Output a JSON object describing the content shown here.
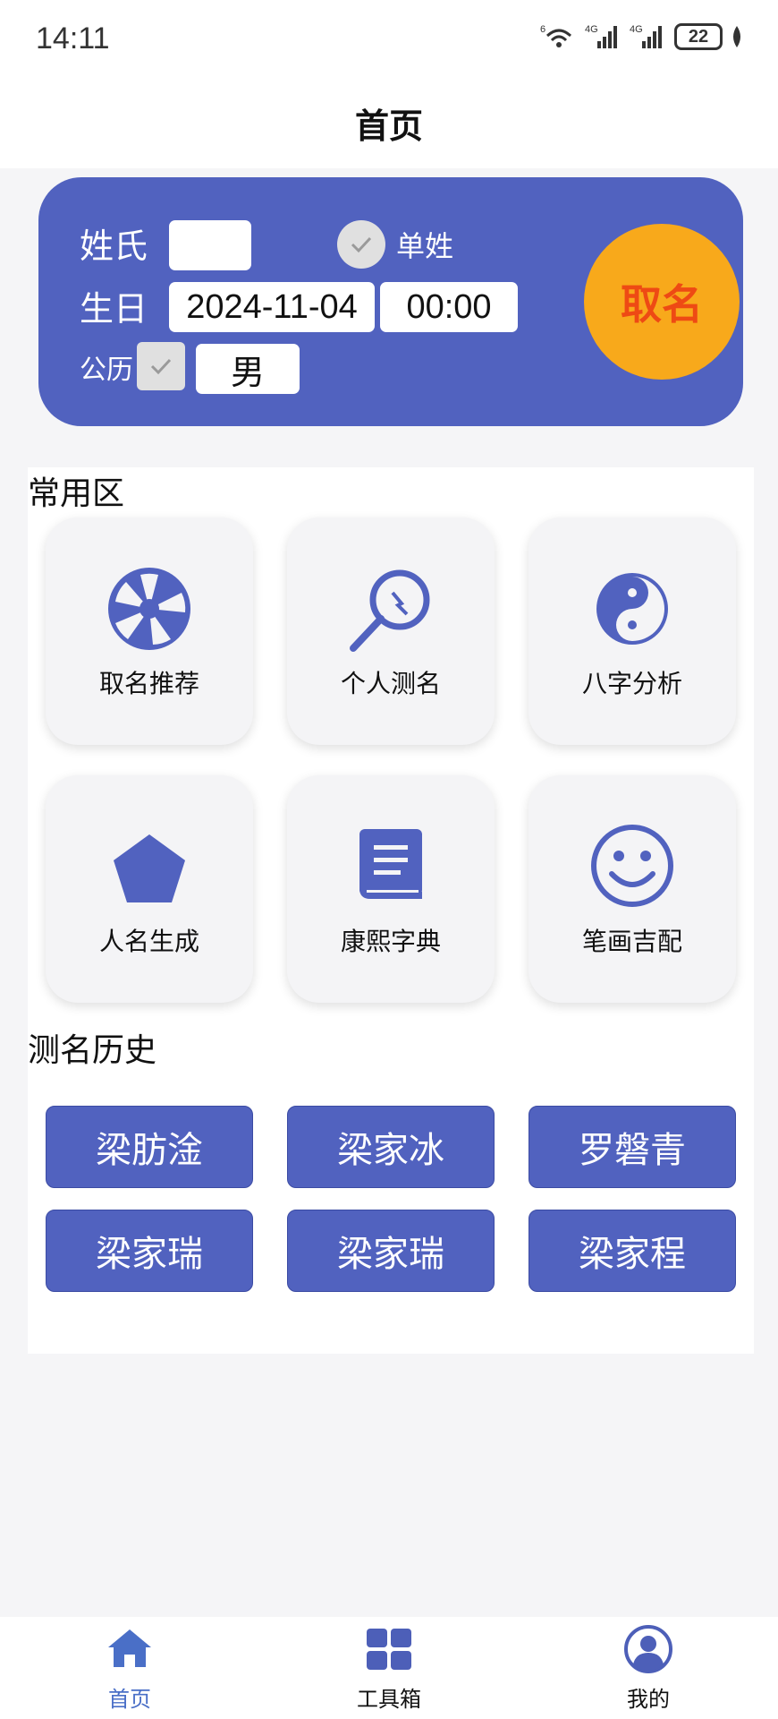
{
  "status": {
    "time": "14:11",
    "battery": "22",
    "net1": "6",
    "net2": "4G",
    "net3": "4G"
  },
  "nav": {
    "title": "首页"
  },
  "form": {
    "surname_label": "姓氏",
    "surname_value": "",
    "single_surname_label": "单姓",
    "birthday_label": "生日",
    "date_value": "2024-11-04",
    "time_value": "00:00",
    "calendar_label": "公历",
    "gender_value": "男",
    "submit_label": "取名"
  },
  "common": {
    "title": "常用区",
    "tiles": [
      {
        "label": "取名推荐",
        "icon": "wheel-icon"
      },
      {
        "label": "个人测名",
        "icon": "magnifier-icon"
      },
      {
        "label": "八字分析",
        "icon": "yin-yang-icon"
      },
      {
        "label": "人名生成",
        "icon": "pentagon-icon"
      },
      {
        "label": "康熙字典",
        "icon": "book-icon"
      },
      {
        "label": "笔画吉配",
        "icon": "smiley-icon"
      }
    ]
  },
  "history": {
    "title": "测名历史",
    "items": [
      "梁肪淦",
      "梁家冰",
      "罗磐青",
      "梁家瑞",
      "梁家瑞",
      "梁家程"
    ]
  },
  "tabbar": {
    "tabs": [
      {
        "label": "首页",
        "icon": "home-icon"
      },
      {
        "label": "工具箱",
        "icon": "grid-icon"
      },
      {
        "label": "我的",
        "icon": "profile-icon"
      }
    ]
  },
  "colors": {
    "primary": "#5162bf",
    "accent": "#f8a91b",
    "accent_text": "#ee4a14"
  }
}
